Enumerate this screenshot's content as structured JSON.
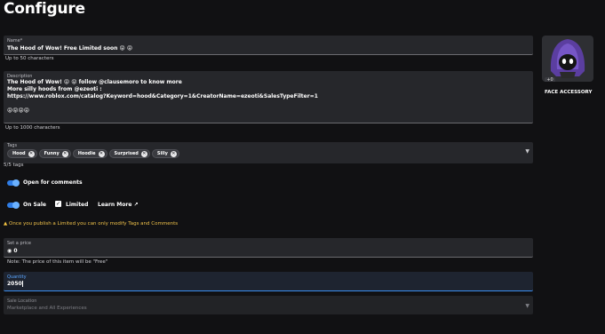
{
  "page": {
    "title": "Configure"
  },
  "name_field": {
    "label": "Name*",
    "value": "The Hood of Wow! Free Limited soon 😝 😝",
    "helper": "Up to 50 characters"
  },
  "description_field": {
    "label": "Description",
    "lines": [
      "The Hood of Wow! 😝 😝 follow @clausemoro to know more",
      "More silly hoods from @ezeoti :",
      "https://www.roblox.com/catalog?Keyword=hood&Category=1&CreatorName=ezeoti&SalesTypeFilter=1",
      "",
      "😝😝😝😝"
    ],
    "helper": "Up to 1000 characters"
  },
  "tags_field": {
    "label": "Tags",
    "tags": [
      "Hood",
      "Funny",
      "Hoodie",
      "Surprised",
      "Silly"
    ],
    "count_text": "5/5 tags"
  },
  "comments": {
    "label": "Open for comments",
    "enabled": true
  },
  "sale": {
    "on_sale_label": "On Sale",
    "limited_label": "Limited",
    "limited_checked": true,
    "learn_more": "Learn More"
  },
  "warning": {
    "text": "Once you publish a Limited you can only modify Tags and Comments"
  },
  "price_field": {
    "label": "Set a price",
    "value": "0",
    "note": "Note: The price of this item will be \"Free\""
  },
  "quantity_field": {
    "label": "Quantity",
    "value": "2050"
  },
  "location_field": {
    "label": "Sale Location",
    "value": "Marketplace and All Experiences"
  },
  "item_card": {
    "badge": "+0",
    "label": "FACE ACCESSORY"
  },
  "colors": {
    "accent": "#2f7de6",
    "warning": "#f5c542",
    "background": "#111113",
    "field": "#26272b"
  }
}
